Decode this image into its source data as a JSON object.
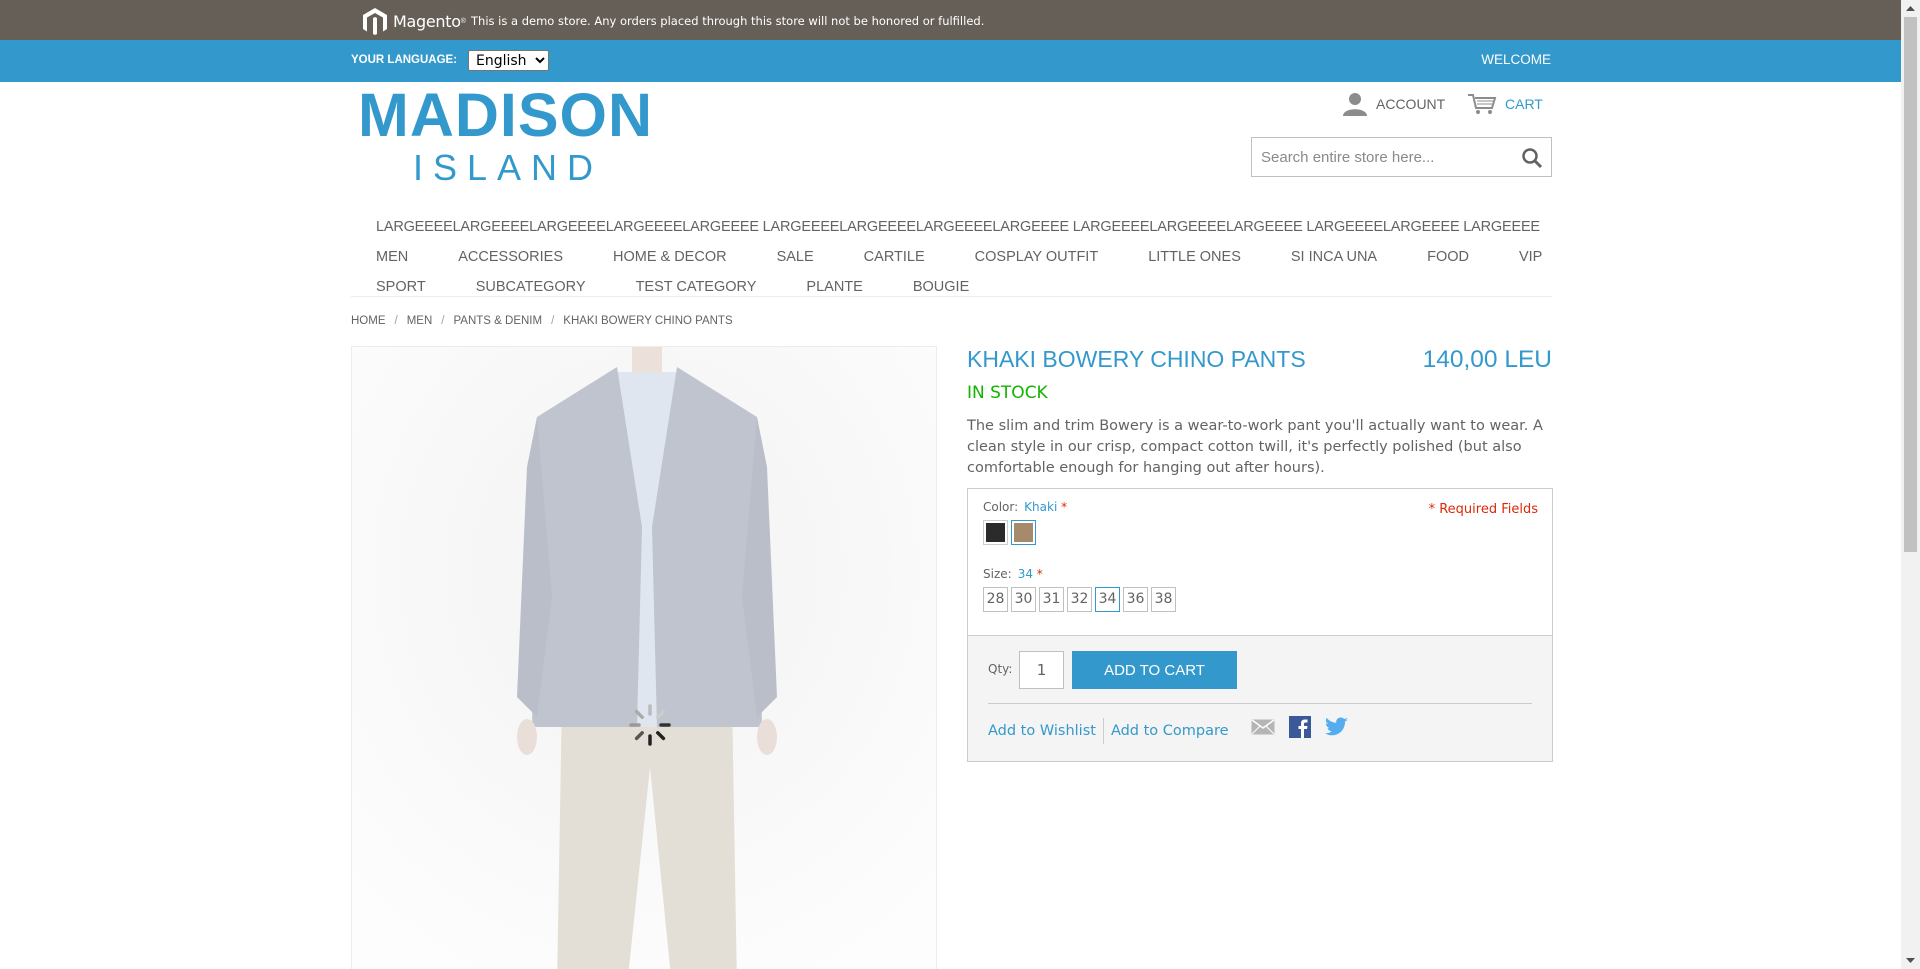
{
  "demo_notice": {
    "brand": "Magento",
    "text": "This is a demo store. Any orders placed through this store will not be honored or fulfilled."
  },
  "language_bar": {
    "label": "YOUR LANGUAGE:",
    "selected_language": "English",
    "welcome": "WELCOME"
  },
  "header": {
    "logo_main": "MADISON",
    "logo_sub": "ISLAND",
    "account_label": "ACCOUNT",
    "cart_label": "CART",
    "search_placeholder": "Search entire store here..."
  },
  "nav": {
    "row1": [
      "LARGEEEELARGEEEELARGEEEELARGEEEELARGEEEE LARGEEEELARGEEEELARGEEEELARGEEEE LARGEEEELARGEEEELARGEEEE LARGEEEELARGEEEE LARGEEEE"
    ],
    "row2": [
      "MEN",
      "ACCESSORIES",
      "HOME & DECOR",
      "SALE",
      "CARTILE",
      "COSPLAY OUTFIT",
      "LITTLE ONES",
      "SI INCA UNA",
      "FOOD",
      "VIP"
    ],
    "row3": [
      "SPORT",
      "SUBCATEGORY",
      "TEST CATEGORY",
      "PLANTE",
      "BOUGIE"
    ]
  },
  "breadcrumb": [
    "HOME",
    "MEN",
    "PANTS & DENIM",
    "KHAKI BOWERY CHINO PANTS"
  ],
  "breadcrumb_separator": "/",
  "product": {
    "name": "KHAKI BOWERY CHINO PANTS",
    "price": "140,00 LEU",
    "stock": "IN STOCK",
    "description": "The slim and trim Bowery is a wear-to-work pant you'll actually want to wear. A clean style in our crisp, compact cotton twill, it's perfectly polished (but also comfortable enough for hanging out after hours).",
    "required_fields": "* Required Fields",
    "color_label": "Color:",
    "color_selected": "Khaki",
    "colors": [
      {
        "name": "Charcoal",
        "hex": "#2b2b2b"
      },
      {
        "name": "Khaki",
        "hex": "#a58b6c",
        "selected": true
      }
    ],
    "size_label": "Size:",
    "size_selected": "34",
    "sizes": [
      "28",
      "30",
      "31",
      "32",
      "34",
      "36",
      "38"
    ],
    "qty_label": "Qty:",
    "qty_value": "1",
    "add_to_cart": "ADD TO CART",
    "wishlist": "Add to Wishlist",
    "compare": "Add to Compare"
  },
  "colors": {
    "brand_blue": "#3399cc",
    "demo_bar": "#665f57",
    "in_stock": "#11b400",
    "required": "#df280a"
  }
}
